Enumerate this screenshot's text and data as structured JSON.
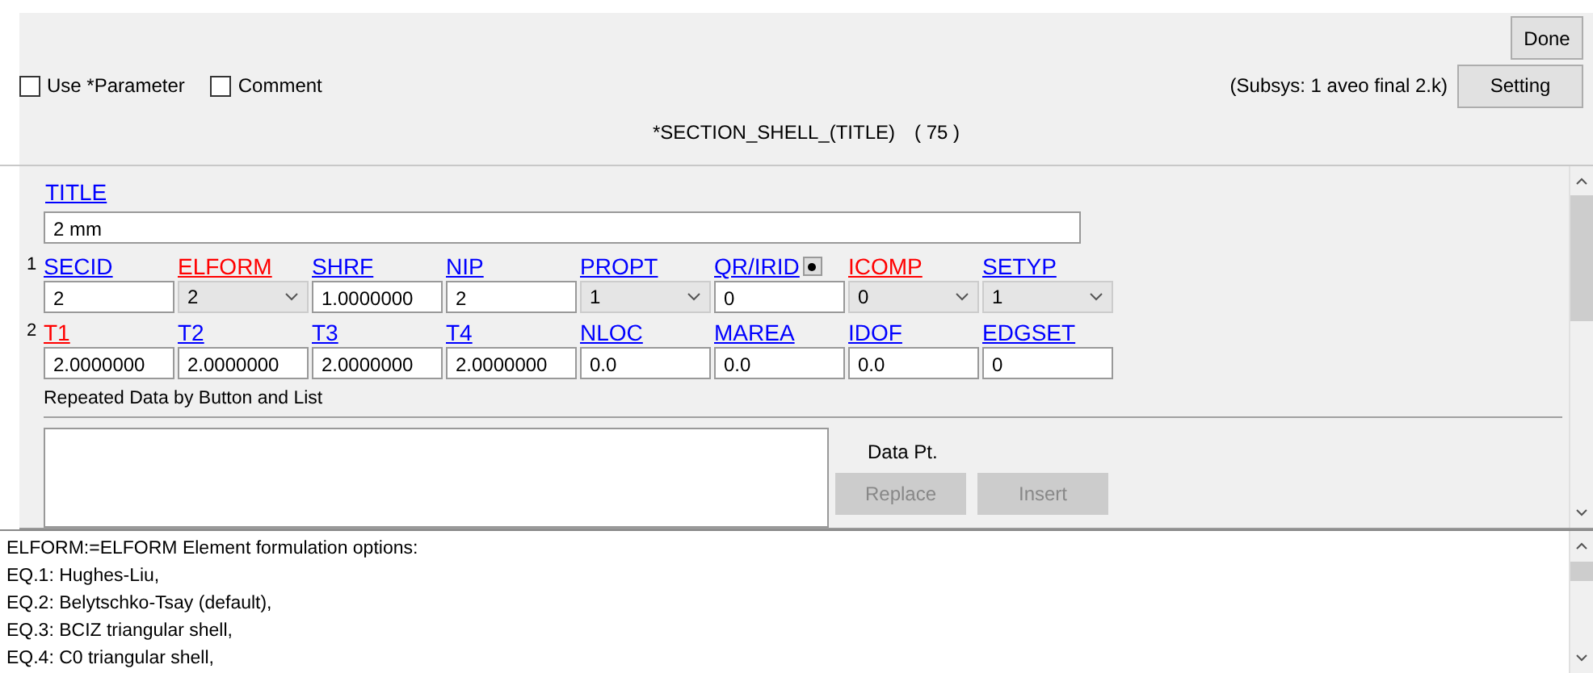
{
  "toolbar": {
    "done_button": "Done",
    "options": [
      {
        "label": "Use *Parameter",
        "checked": false
      },
      {
        "label": "Comment",
        "checked": false
      }
    ],
    "subsys": "(Subsys: 1 aveo final 2.k)",
    "setting_button": "Setting"
  },
  "keyword_title": "*SECTION_SHELL_(TITLE)",
  "keyword_count": "( 75 )",
  "form": {
    "title_label": "TITLE",
    "title_value": "2 mm",
    "cards": [
      {
        "number": "1",
        "fields": [
          {
            "label": "SECID",
            "color": "#0000ff",
            "kind": "text",
            "value": "2"
          },
          {
            "label": "ELFORM",
            "color": "#ff0000",
            "kind": "select",
            "value": "2"
          },
          {
            "label": "SHRF",
            "color": "#0000ff",
            "kind": "text",
            "value": "1.0000000"
          },
          {
            "label": "NIP",
            "color": "#0000ff",
            "kind": "text",
            "value": "2"
          },
          {
            "label": "PROPT",
            "color": "#0000ff",
            "kind": "select",
            "value": "1"
          },
          {
            "label": "QR/IRID",
            "color": "#0000ff",
            "kind": "text",
            "value": "0",
            "picker": true
          },
          {
            "label": "ICOMP",
            "color": "#ff0000",
            "kind": "select",
            "value": "0"
          },
          {
            "label": "SETYP",
            "color": "#0000ff",
            "kind": "select",
            "value": "1"
          }
        ]
      },
      {
        "number": "2",
        "fields": [
          {
            "label": "T1",
            "color": "#ff0000",
            "kind": "text",
            "value": "2.0000000"
          },
          {
            "label": "T2",
            "color": "#0000ff",
            "kind": "text",
            "value": "2.0000000"
          },
          {
            "label": "T3",
            "color": "#0000ff",
            "kind": "text",
            "value": "2.0000000"
          },
          {
            "label": "T4",
            "color": "#0000ff",
            "kind": "text",
            "value": "2.0000000"
          },
          {
            "label": "NLOC",
            "color": "#0000ff",
            "kind": "text",
            "value": "0.0"
          },
          {
            "label": "MAREA",
            "color": "#0000ff",
            "kind": "text",
            "value": "0.0"
          },
          {
            "label": "IDOF",
            "color": "#0000ff",
            "kind": "text",
            "value": "0.0"
          },
          {
            "label": "EDGSET",
            "color": "#0000ff",
            "kind": "text",
            "value": "0"
          }
        ]
      }
    ],
    "repeated_heading": "Repeated Data by Button and List",
    "data_pt_label": "Data Pt.",
    "buttons": [
      {
        "label": "Replace",
        "disabled": true
      },
      {
        "label": "Insert",
        "disabled": true
      }
    ]
  },
  "help_lines": [
    "ELFORM:=ELFORM Element formulation options:",
    "EQ.1: Hughes-Liu,",
    "EQ.2: Belytschko-Tsay (default),",
    "EQ.3: BCIZ triangular shell,",
    "EQ.4: C0 triangular shell,"
  ]
}
